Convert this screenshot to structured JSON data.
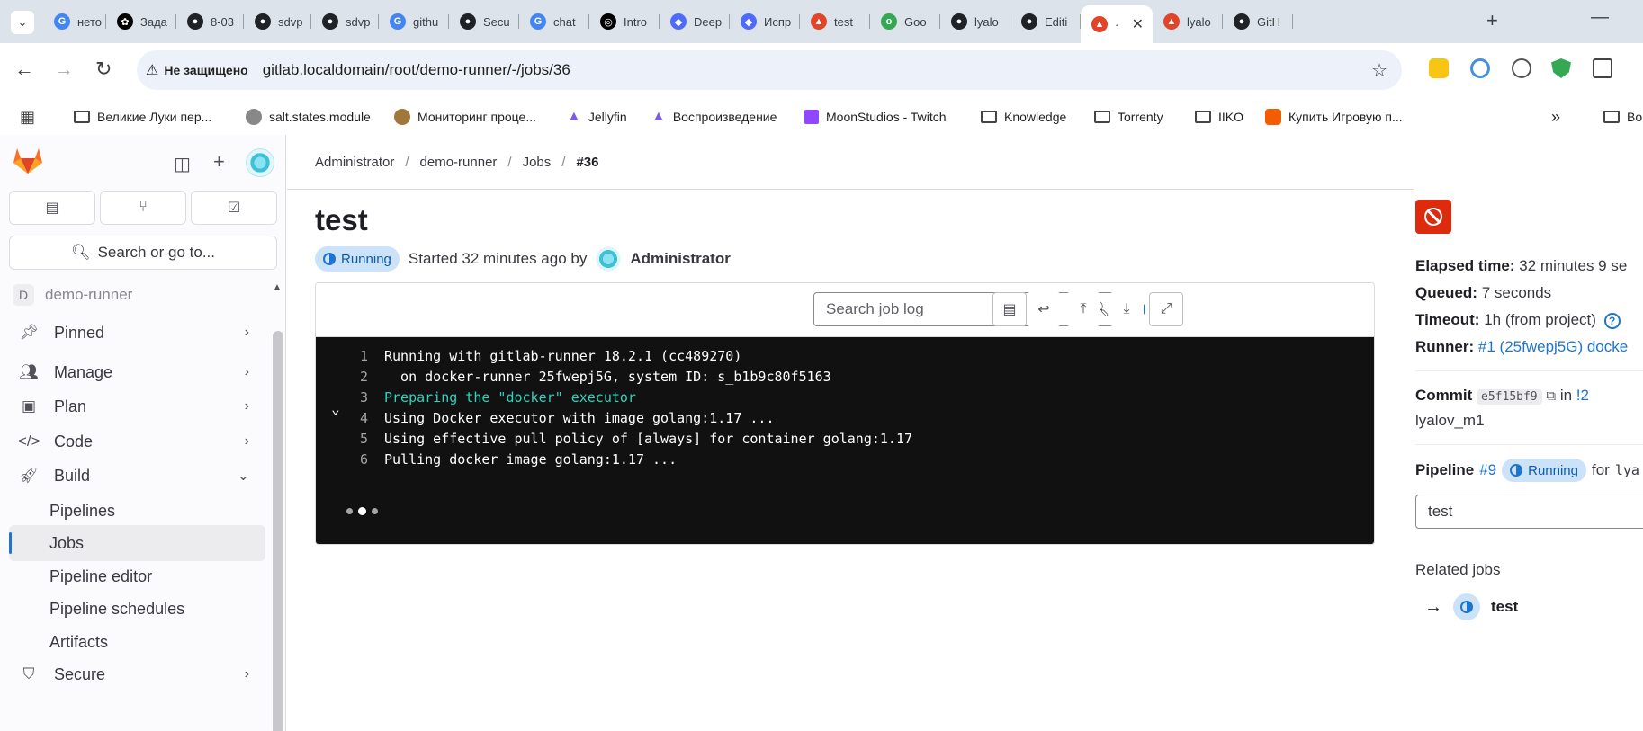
{
  "browser": {
    "tabs": [
      {
        "label": "нето",
        "fav": "G",
        "color": "#4285f4"
      },
      {
        "label": "Зада",
        "fav": "✿",
        "color": "#000000"
      },
      {
        "label": "8-03",
        "fav": "●",
        "color": "#1f2328"
      },
      {
        "label": "sdvp",
        "fav": "●",
        "color": "#1f2328"
      },
      {
        "label": "sdvp",
        "fav": "●",
        "color": "#1f2328"
      },
      {
        "label": "githu",
        "fav": "G",
        "color": "#4285f4"
      },
      {
        "label": "Secu",
        "fav": "●",
        "color": "#1f2328"
      },
      {
        "label": "chat",
        "fav": "G",
        "color": "#4285f4"
      },
      {
        "label": "Intro",
        "fav": "◎",
        "color": "#000000"
      },
      {
        "label": "Deep",
        "fav": "◆",
        "color": "#4d6bfe"
      },
      {
        "label": "Испр",
        "fav": "◆",
        "color": "#4d6bfe"
      },
      {
        "label": "test",
        "fav": "▲",
        "color": "#e24329"
      },
      {
        "label": "Goo",
        "fav": "о",
        "color": "#34a853"
      },
      {
        "label": "lyalo",
        "fav": "●",
        "color": "#1f2328"
      },
      {
        "label": "Editi",
        "fav": "●",
        "color": "#1f2328"
      },
      {
        "label": "·",
        "fav": "▲",
        "color": "#e24329",
        "active": true
      },
      {
        "label": "lyalo",
        "fav": "▲",
        "color": "#e24329"
      },
      {
        "label": "GitH",
        "fav": "●",
        "color": "#1f2328"
      }
    ],
    "security_chip": "Не защищено",
    "url": "gitlab.localdomain/root/demo-runner/-/jobs/36",
    "bookmarks": [
      "Великие Луки пер...",
      "salt.states.module",
      "Мониторинг проце...",
      "Jellyfin",
      "Воспроизведение",
      "MoonStudios - Twitch",
      "Knowledge",
      "Torrenty",
      "IIKO",
      "Купить Игровую п...",
      "Во"
    ]
  },
  "sidebar": {
    "search_label": "Search or go to...",
    "project_initial": "D",
    "project_name": "demo-runner",
    "items": {
      "pinned": "Pinned",
      "manage": "Manage",
      "plan": "Plan",
      "code": "Code",
      "build": "Build",
      "pipelines": "Pipelines",
      "jobs": "Jobs",
      "pipeline_editor": "Pipeline editor",
      "pipeline_schedules": "Pipeline schedules",
      "artifacts": "Artifacts",
      "secure": "Secure"
    }
  },
  "breadcrumb": [
    "Administrator",
    "demo-runner",
    "Jobs",
    "#36"
  ],
  "job": {
    "title": "test",
    "status": "Running",
    "started_text": "Started 32 minutes ago by",
    "started_by": "Administrator"
  },
  "log": {
    "search_placeholder": "Search job log",
    "lines": [
      {
        "n": "1",
        "text": "Running with gitlab-runner 18.2.1 (cc489270)",
        "kind": "normal"
      },
      {
        "n": "2",
        "text": "  on docker-runner 25fwepj5G, system ID: s_b1b9c80f5163",
        "kind": "normal"
      },
      {
        "n": "3",
        "text": "Preparing the \"docker\" executor",
        "kind": "section"
      },
      {
        "n": "4",
        "text": "Using Docker executor with image golang:1.17 ...",
        "kind": "normal"
      },
      {
        "n": "5",
        "text": "Using effective pull policy of [always] for container golang:1.17",
        "kind": "normal"
      },
      {
        "n": "6",
        "text": "Pulling docker image golang:1.17 ...",
        "kind": "normal"
      }
    ]
  },
  "details": {
    "elapsed_label": "Elapsed time:",
    "elapsed_value": "32 minutes 9 se",
    "queued_label": "Queued:",
    "queued_value": "7 seconds",
    "timeout_label": "Timeout:",
    "timeout_value": "1h (from project)",
    "runner_label": "Runner:",
    "runner_value": "#1 (25fwepj5G) docke",
    "commit_label": "Commit",
    "commit_sha": "e5f15bf9",
    "commit_in": "in",
    "commit_mr": "!2",
    "commit_author": "lyalov_m1",
    "pipeline_label": "Pipeline",
    "pipeline_id": "#9",
    "pipeline_status": "Running",
    "pipeline_for": "for",
    "pipeline_ref": "lya",
    "job_select": "test",
    "related_title": "Related jobs",
    "related_job": "test"
  }
}
